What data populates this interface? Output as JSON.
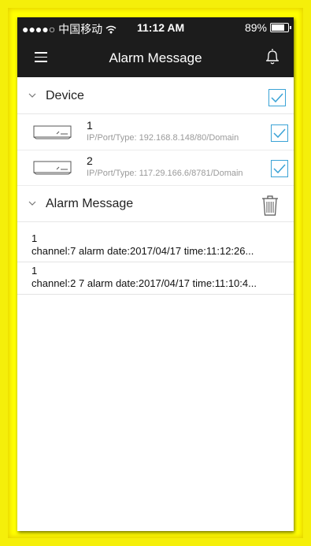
{
  "status_bar": {
    "carrier": "●●●●○ 中国移动 ",
    "wifi_icon": "wifi-icon",
    "time": "11:12 AM",
    "battery": "89%",
    "battery_level": 0.89
  },
  "nav": {
    "title": "Alarm Message",
    "menu_icon": "menu-icon",
    "bell_icon": "bell-icon"
  },
  "device_section": {
    "title": "Device",
    "checked": true,
    "devices": [
      {
        "name": "1",
        "info": "IP/Port/Type: 192.168.8.148/80/Domain",
        "checked": true
      },
      {
        "name": "2",
        "info": "IP/Port/Type: 117.29.166.6/8781/Domain",
        "checked": true
      }
    ]
  },
  "alarm_section": {
    "title": "Alarm Message",
    "messages": [
      {
        "id": "1",
        "text": "channel:7  alarm  date:2017/04/17  time:11:12:26..."
      },
      {
        "id": "1",
        "text": "channel:2 7  alarm  date:2017/04/17  time:11:10:4..."
      }
    ]
  },
  "colors": {
    "accent": "#3aa3d6",
    "nav_bg": "#1c1c1c",
    "border": "#ffff00"
  }
}
